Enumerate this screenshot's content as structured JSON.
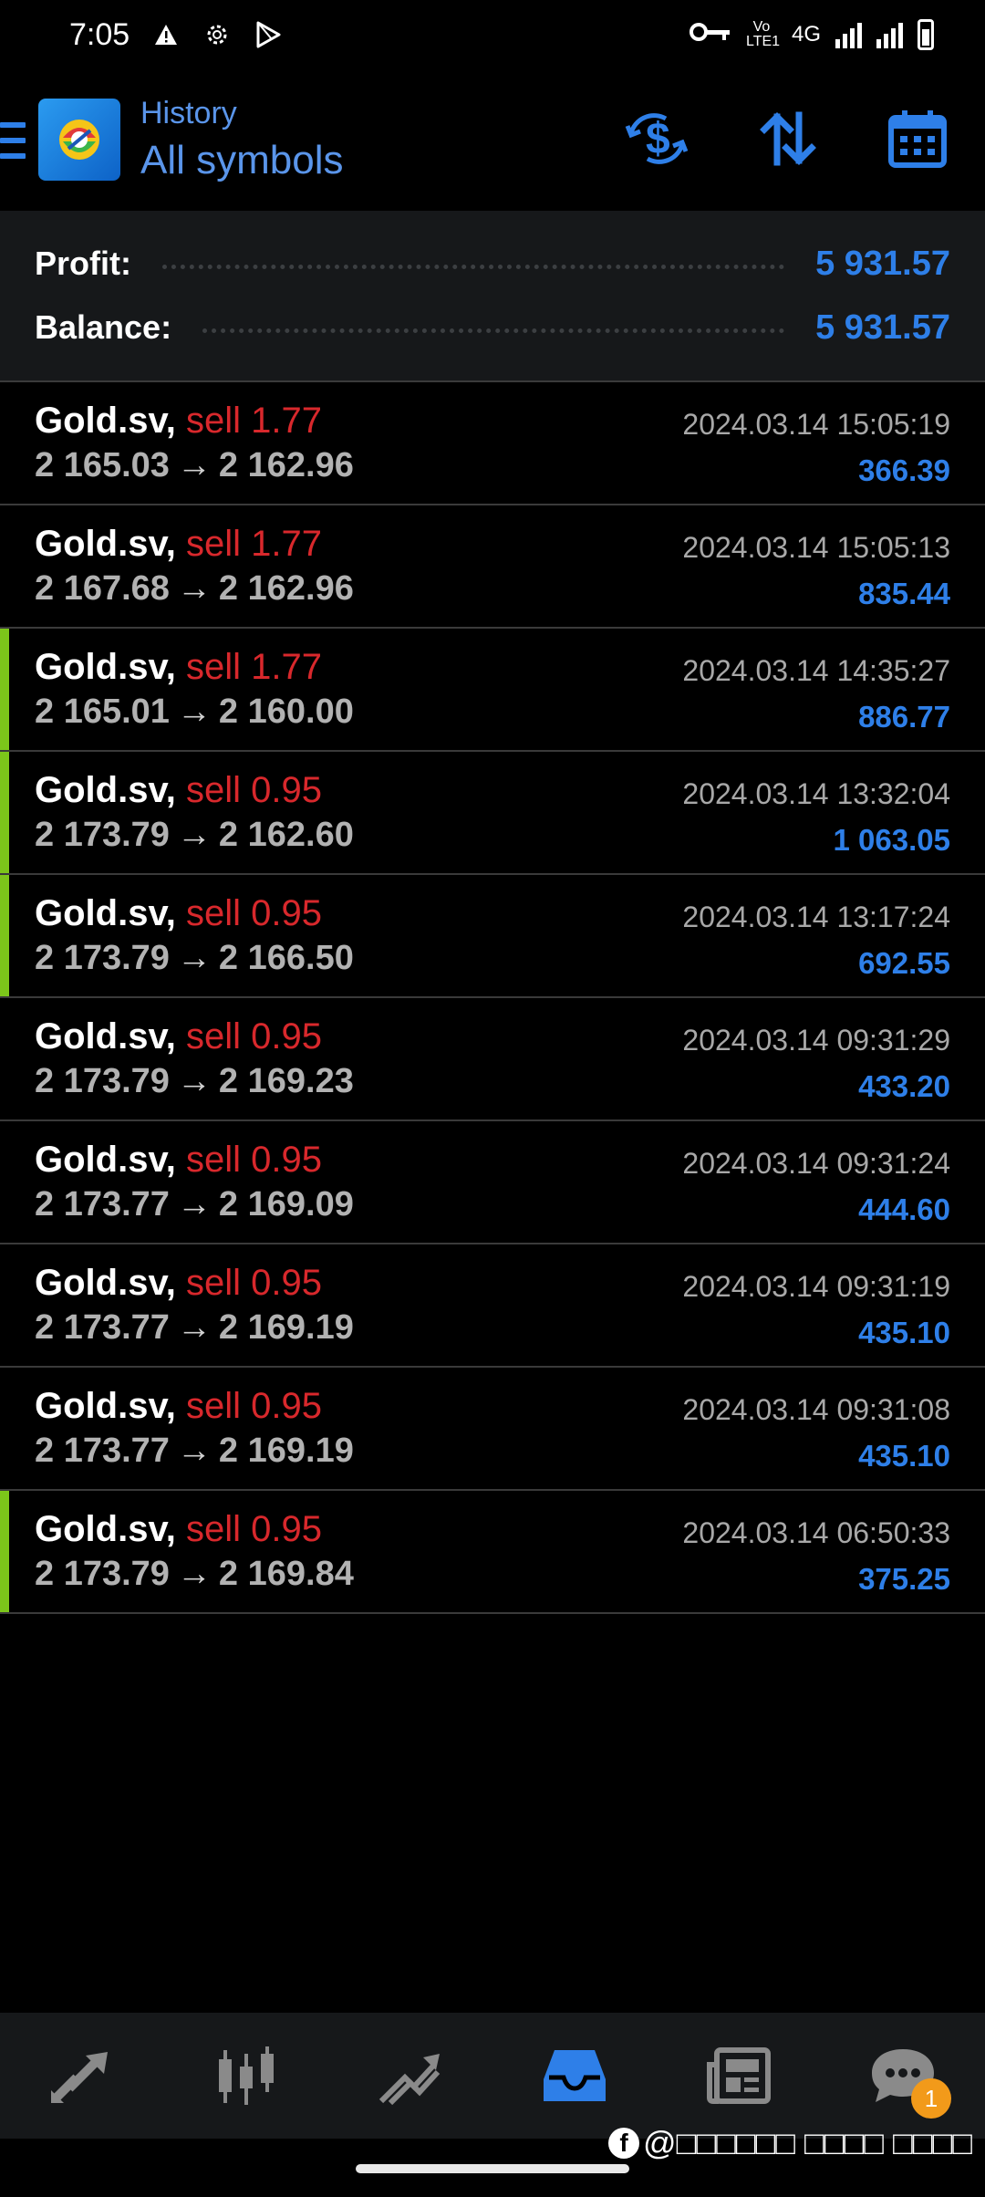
{
  "status_bar": {
    "time": "7:05",
    "network_label": "4G",
    "volte_label": "Vo LTE1",
    "icons": [
      "warning-icon",
      "settings-gear-icon",
      "play-store-icon",
      "vpn-key-icon",
      "signal-icon",
      "battery-icon"
    ]
  },
  "header": {
    "title": "History",
    "subtitle": "All symbols",
    "actions": [
      "currency-icon",
      "sort-icon",
      "calendar-icon"
    ]
  },
  "summary": {
    "profit_label": "Profit:",
    "profit_value": "5 931.57",
    "balance_label": "Balance:",
    "balance_value": "5 931.57"
  },
  "deals": [
    {
      "symbol": "Gold.sv,",
      "type": "sell 1.77",
      "open": "2 165.03",
      "close": "2 162.96",
      "time": "2024.03.14 15:05:19",
      "profit": "366.39",
      "marked": false
    },
    {
      "symbol": "Gold.sv,",
      "type": "sell 1.77",
      "open": "2 167.68",
      "close": "2 162.96",
      "time": "2024.03.14 15:05:13",
      "profit": "835.44",
      "marked": false
    },
    {
      "symbol": "Gold.sv,",
      "type": "sell 1.77",
      "open": "2 165.01",
      "close": "2 160.00",
      "time": "2024.03.14 14:35:27",
      "profit": "886.77",
      "marked": true
    },
    {
      "symbol": "Gold.sv,",
      "type": "sell 0.95",
      "open": "2 173.79",
      "close": "2 162.60",
      "time": "2024.03.14 13:32:04",
      "profit": "1 063.05",
      "marked": true
    },
    {
      "symbol": "Gold.sv,",
      "type": "sell 0.95",
      "open": "2 173.79",
      "close": "2 166.50",
      "time": "2024.03.14 13:17:24",
      "profit": "692.55",
      "marked": true
    },
    {
      "symbol": "Gold.sv,",
      "type": "sell 0.95",
      "open": "2 173.79",
      "close": "2 169.23",
      "time": "2024.03.14 09:31:29",
      "profit": "433.20",
      "marked": false
    },
    {
      "symbol": "Gold.sv,",
      "type": "sell 0.95",
      "open": "2 173.77",
      "close": "2 169.09",
      "time": "2024.03.14 09:31:24",
      "profit": "444.60",
      "marked": false
    },
    {
      "symbol": "Gold.sv,",
      "type": "sell 0.95",
      "open": "2 173.77",
      "close": "2 169.19",
      "time": "2024.03.14 09:31:19",
      "profit": "435.10",
      "marked": false
    },
    {
      "symbol": "Gold.sv,",
      "type": "sell 0.95",
      "open": "2 173.77",
      "close": "2 169.19",
      "time": "2024.03.14 09:31:08",
      "profit": "435.10",
      "marked": false
    },
    {
      "symbol": "Gold.sv,",
      "type": "sell 0.95",
      "open": "2 173.79",
      "close": "2 169.84",
      "time": "2024.03.14 06:50:33",
      "profit": "375.25",
      "marked": true
    }
  ],
  "arrow": "→",
  "bottom_nav": {
    "items": [
      "quotes-icon",
      "chart-icon",
      "trade-icon",
      "history-icon",
      "news-icon",
      "messages-icon"
    ],
    "active": "history-icon",
    "messages_badge": "1"
  },
  "watermark": {
    "fb_letter": "f",
    "text": "@□□□□□□ □□□□ □□□□"
  },
  "colors": {
    "accent": "#2e7fe8",
    "sell": "#d8282c",
    "marker": "#7cc61a",
    "summary_bg": "#16181a"
  }
}
